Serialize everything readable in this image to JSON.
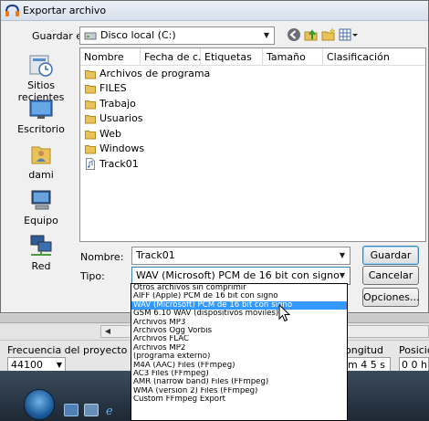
{
  "dialog": {
    "title": "Exportar archivo",
    "save_in_label": "Guardar en:",
    "location": "Disco local (C:)",
    "columns": [
      "Nombre",
      "Fecha de c...",
      "Etiquetas",
      "Tamaño",
      "Clasificación"
    ],
    "places": [
      {
        "label": "Sitios recientes",
        "icon": "recent-places-icon"
      },
      {
        "label": "Escritorio",
        "icon": "desktop-icon"
      },
      {
        "label": "dami",
        "icon": "user-folder-icon"
      },
      {
        "label": "Equipo",
        "icon": "computer-icon"
      },
      {
        "label": "Red",
        "icon": "network-icon"
      }
    ],
    "files": [
      {
        "name": "Archivos de programa",
        "icon": "folder-icon"
      },
      {
        "name": "FILES",
        "icon": "folder-icon"
      },
      {
        "name": "Trabajo",
        "icon": "folder-icon"
      },
      {
        "name": "Usuarios",
        "icon": "folder-icon"
      },
      {
        "name": "Web",
        "icon": "folder-icon"
      },
      {
        "name": "Windows",
        "icon": "folder-icon"
      },
      {
        "name": "Track01",
        "icon": "audio-file-icon"
      }
    ],
    "filename_label": "Nombre:",
    "filename_value": "Track01",
    "type_label": "Tipo:",
    "type_value": "WAV (Microsoft) PCM de 16 bit con signo",
    "save_button": "Guardar",
    "cancel_button": "Cancelar",
    "options_button": "Opciones...",
    "type_options": [
      "Otros archivos sin comprimir",
      "AIFF (Apple) PCM de 16 bit con signo",
      "WAV (Microsoft) PCM de 16 bit con signo",
      "GSM 6.10 WAV (dispositivos móviles)",
      "Archivos MP3",
      "Archivos Ogg Vorbis",
      "Archivos FLAC",
      "Archivos MP2",
      "(programa externo)",
      "M4A (AAC) Files (FFmpeg)",
      "AC3 Files (FFmpeg)",
      "AMR (narrow band) Files (FFmpeg)",
      "WMA (version 2) Files (FFmpeg)",
      "Custom FFmpeg Export"
    ],
    "selected_option_index": 2
  },
  "background_app": {
    "freq_label": "Frecuencia del proyecto (Hz):",
    "freq_value": "44100",
    "length_label": "ongitud",
    "length_value": "m 4 5 s",
    "position_label": "Posició",
    "position_value": "0 0 h"
  },
  "colors": {
    "selection": "#3399ff",
    "taskbar": "#1d2834",
    "folder": "#e9c35a"
  }
}
